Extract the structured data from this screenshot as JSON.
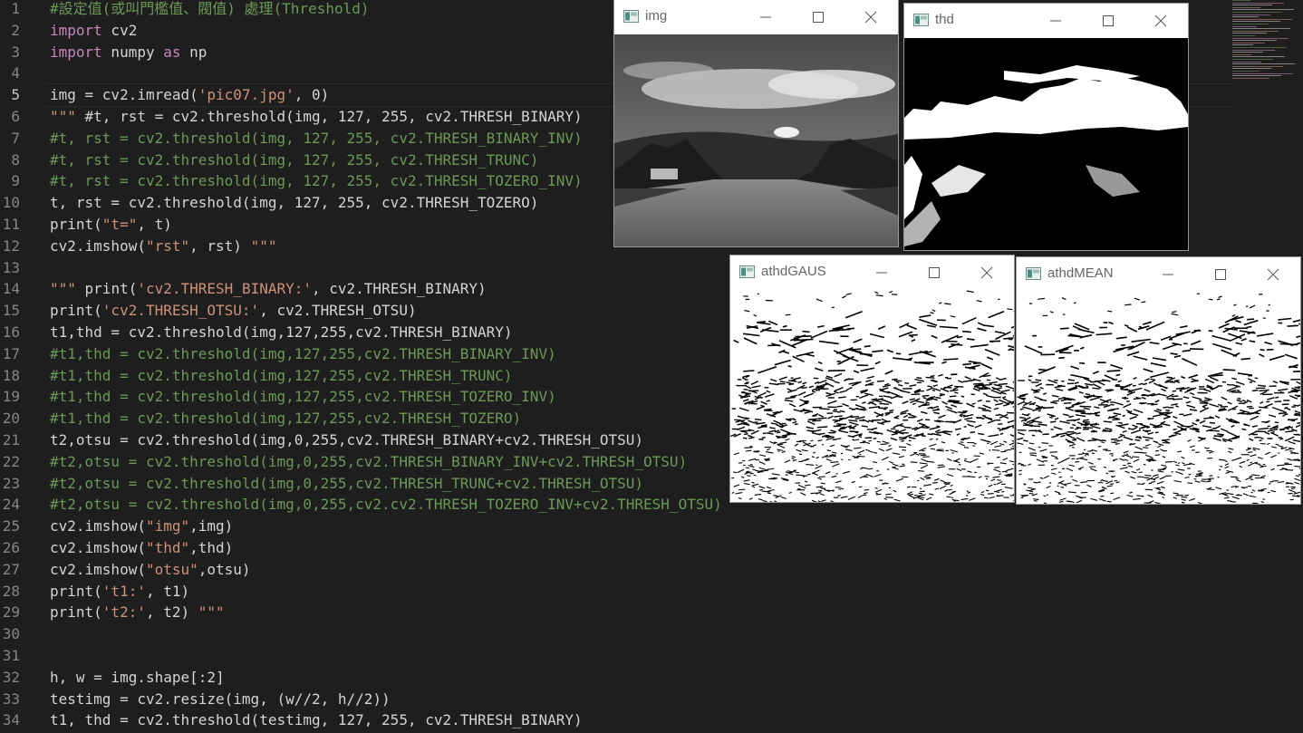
{
  "colors": {
    "background": "#1e1e1e",
    "comment": "#6a9955",
    "keyword": "#c586c0",
    "string": "#ce9178",
    "text": "#d4d4d4",
    "line_number": "#858585",
    "squiggle": "#f14c4c"
  },
  "editor": {
    "lines": [
      {
        "n": "1",
        "text": "#設定值(或叫門檻值、閥值) 處理(Threshold)"
      },
      {
        "n": "2",
        "text": "import cv2"
      },
      {
        "n": "3",
        "text": "import numpy as np"
      },
      {
        "n": "4",
        "text": ""
      },
      {
        "n": "5",
        "text": "img = cv2.imread('pic07.jpg', 0)"
      },
      {
        "n": "6",
        "text": "\"\"\" #t, rst = cv2.threshold(img, 127, 255, cv2.THRESH_BINARY)"
      },
      {
        "n": "7",
        "text": "#t, rst = cv2.threshold(img, 127, 255, cv2.THRESH_BINARY_INV)"
      },
      {
        "n": "8",
        "text": "#t, rst = cv2.threshold(img, 127, 255, cv2.THRESH_TRUNC)"
      },
      {
        "n": "9",
        "text": "#t, rst = cv2.threshold(img, 127, 255, cv2.THRESH_TOZERO_INV)"
      },
      {
        "n": "10",
        "text": "t, rst = cv2.threshold(img, 127, 255, cv2.THRESH_TOZERO)"
      },
      {
        "n": "11",
        "text": "print(\"t=\", t)"
      },
      {
        "n": "12",
        "text": "cv2.imshow(\"rst\", rst) \"\"\""
      },
      {
        "n": "13",
        "text": ""
      },
      {
        "n": "14",
        "text": "\"\"\" print('cv2.THRESH_BINARY:', cv2.THRESH_BINARY)"
      },
      {
        "n": "15",
        "text": "print('cv2.THRESH_OTSU:', cv2.THRESH_OTSU)"
      },
      {
        "n": "16",
        "text": "t1,thd = cv2.threshold(img,127,255,cv2.THRESH_BINARY)"
      },
      {
        "n": "17",
        "text": "#t1,thd = cv2.threshold(img,127,255,cv2.THRESH_BINARY_INV)"
      },
      {
        "n": "18",
        "text": "#t1,thd = cv2.threshold(img,127,255,cv2.THRESH_TRUNC)"
      },
      {
        "n": "19",
        "text": "#t1,thd = cv2.threshold(img,127,255,cv2.THRESH_TOZERO_INV)"
      },
      {
        "n": "20",
        "text": "#t1,thd = cv2.threshold(img,127,255,cv2.THRESH_TOZERO)"
      },
      {
        "n": "21",
        "text": "t2,otsu = cv2.threshold(img,0,255,cv2.THRESH_BINARY+cv2.THRESH_OTSU)"
      },
      {
        "n": "22",
        "text": "#t2,otsu = cv2.threshold(img,0,255,cv2.THRESH_BINARY_INV+cv2.THRESH_OTSU)"
      },
      {
        "n": "23",
        "text": "#t2,otsu = cv2.threshold(img,0,255,cv2.THRESH_TRUNC+cv2.THRESH_OTSU)"
      },
      {
        "n": "24",
        "text": "#t2,otsu = cv2.threshold(img,0,255,cv2.cv2.THRESH_TOZERO_INV+cv2.THRESH_OTSU)"
      },
      {
        "n": "25",
        "text": "cv2.imshow(\"img\",img)"
      },
      {
        "n": "26",
        "text": "cv2.imshow(\"thd\",thd)"
      },
      {
        "n": "27",
        "text": "cv2.imshow(\"otsu\",otsu)"
      },
      {
        "n": "28",
        "text": "print('t1:', t1)"
      },
      {
        "n": "29",
        "text": "print('t2:', t2) \"\"\""
      },
      {
        "n": "30",
        "text": ""
      },
      {
        "n": "31",
        "text": ""
      },
      {
        "n": "32",
        "text": "h, w = img.shape[:2]"
      },
      {
        "n": "33",
        "text": "testimg = cv2.resize(img, (w//2, h//2))"
      },
      {
        "n": "34",
        "text": "t1, thd = cv2.threshold(testimg, 127, 255, cv2.THRESH_BINARY)"
      }
    ]
  },
  "windows": {
    "img": {
      "title": "img"
    },
    "thd": {
      "title": "thd"
    },
    "athdGAUS": {
      "title": "athdGAUS"
    },
    "athdMEAN": {
      "title": "athdMEAN"
    }
  },
  "icons": {
    "window_icon": "opencv-window-icon",
    "minimize": "minimize-icon",
    "maximize": "maximize-icon",
    "close": "close-icon"
  }
}
